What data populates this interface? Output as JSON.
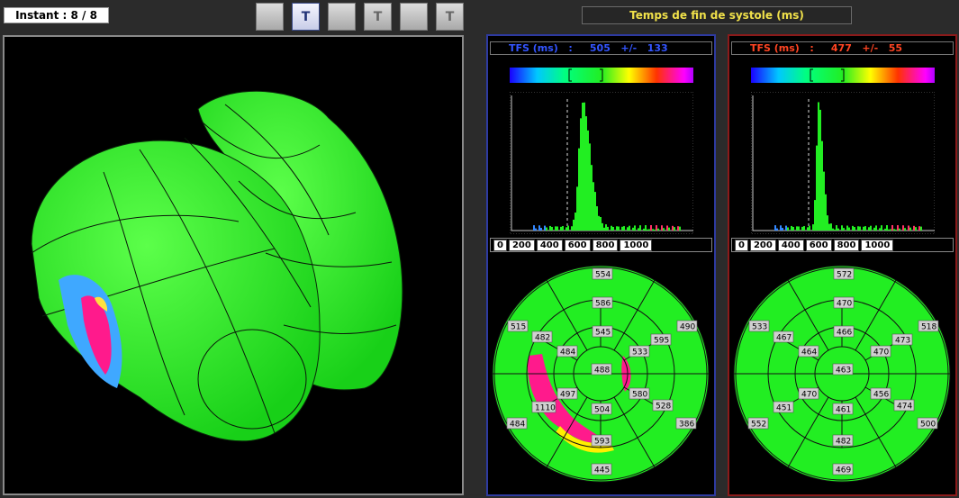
{
  "instant_label": "Instant : 8 / 8",
  "toolbar": {
    "buttons": [
      {
        "name": "curve-down-icon",
        "glyph": ""
      },
      {
        "name": "t-wave-down-icon",
        "glyph": "T"
      },
      {
        "name": "curve-corner-icon",
        "glyph": ""
      },
      {
        "name": "t-wave-icon",
        "glyph": "T"
      },
      {
        "name": "curve-corner-icon-2",
        "glyph": ""
      },
      {
        "name": "t-wave-up-icon",
        "glyph": "T"
      }
    ],
    "active_index": 1
  },
  "title": "Temps de fin de systole (ms)",
  "colors": {
    "left_panel": "#2e3aa0",
    "right_panel": "#8b1a1a",
    "title": "#f0e14a",
    "mesh": "#22ee22"
  },
  "panels": {
    "left": {
      "stats": {
        "label": "TFS (ms)",
        "sep": ":",
        "mean": "505",
        "pm": "+/-",
        "sd": "133"
      },
      "stats_color": "#3355ff",
      "ticks": [
        "0",
        "200",
        "400",
        "600",
        "800",
        "1000"
      ],
      "bullseye": [
        "554",
        "586",
        "515",
        "482",
        "545",
        "490",
        "595",
        "484",
        "533",
        "488",
        "497",
        "580",
        "1110",
        "504",
        "528",
        "484",
        "386",
        "593",
        "445"
      ]
    },
    "right": {
      "stats": {
        "label": "TFS (ms)",
        "sep": ":",
        "mean": "477",
        "pm": "+/-",
        "sd": "55"
      },
      "stats_color": "#ff4422",
      "ticks": [
        "0",
        "200",
        "400",
        "600",
        "800",
        "1000"
      ],
      "bullseye": [
        "572",
        "470",
        "533",
        "467",
        "466",
        "518",
        "473",
        "464",
        "470",
        "463",
        "470",
        "456",
        "451",
        "461",
        "474",
        "552",
        "500",
        "482",
        "469"
      ]
    }
  }
}
